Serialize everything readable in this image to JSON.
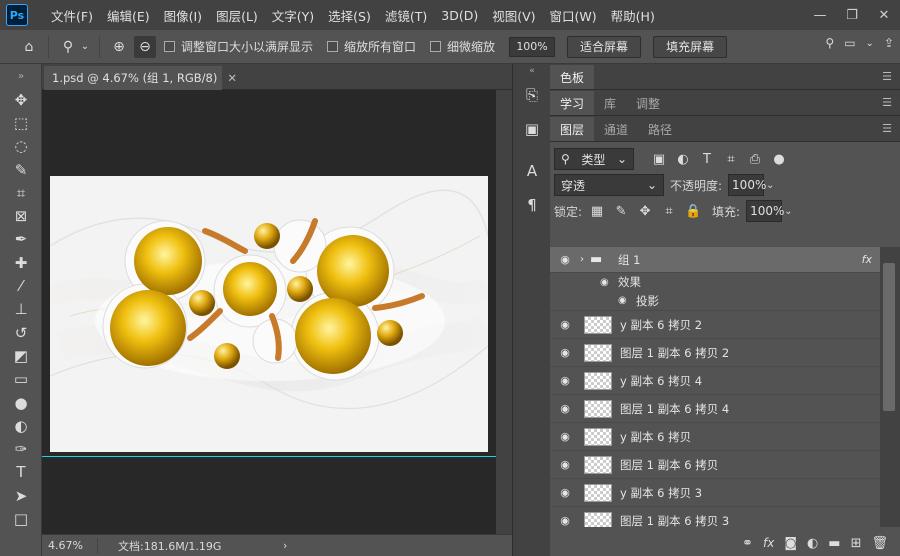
{
  "app": {
    "logo": "Ps"
  },
  "menu": [
    "文件(F)",
    "编辑(E)",
    "图像(I)",
    "图层(L)",
    "文字(Y)",
    "选择(S)",
    "滤镜(T)",
    "3D(D)",
    "视图(V)",
    "窗口(W)",
    "帮助(H)"
  ],
  "options": {
    "check1": "调整窗口大小以满屏显示",
    "check2": "缩放所有窗口",
    "check3": "细微缩放",
    "zoom_field": "100%",
    "fit_screen": "适合屏幕",
    "fill_screen": "填充屏幕"
  },
  "document": {
    "tab_title": "1.psd @ 4.67% (组 1, RGB/8)"
  },
  "status": {
    "zoom": "4.67%",
    "doc_size": "文档:181.6M/1.19G"
  },
  "panels": {
    "row1": [
      "色板"
    ],
    "row2": [
      "学习",
      "库",
      "调整"
    ],
    "row3": [
      "图层",
      "通道",
      "路径"
    ],
    "filter_kind": "类型",
    "blend_mode": "穿透",
    "opacity_label": "不透明度:",
    "opacity_value": "100%",
    "lock_label": "锁定:",
    "fill_label": "填充:",
    "fill_value": "100%"
  },
  "layers": {
    "group_name": "组 1",
    "effects_label": "效果",
    "shadow_label": "投影",
    "items": [
      "y 副本 6 拷贝 2",
      "图层 1 副本 6 拷贝 2",
      "y 副本 6 拷贝 4",
      "图层 1 副本 6 拷贝 4",
      "y 副本 6 拷贝",
      "图层 1 副本 6 拷贝",
      "y 副本 6 拷贝 3",
      "图层 1 副本 6 拷贝 3"
    ]
  }
}
